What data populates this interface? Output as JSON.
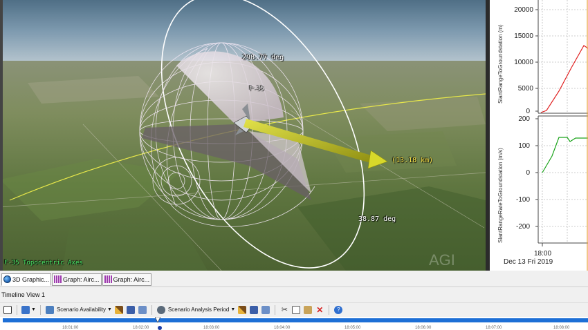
{
  "viewport": {
    "labels": {
      "azimuth": "298.77 deg",
      "elevation": "38.87 deg",
      "range": "(13.18 km)",
      "aircraft": "F-35",
      "axes": "F-35 Topocentric Axes",
      "watermark": "AGI"
    }
  },
  "graph": {
    "top_ylabel": "SlantRangeToGroundstation (m)",
    "bottom_ylabel": "SlantRangeRateToGroundstation (m/s)",
    "top_ticks": [
      "20000",
      "15000",
      "10000",
      "5000",
      "0"
    ],
    "bottom_ticks": [
      "200",
      "100",
      "0",
      "-100",
      "-200"
    ],
    "x_tick": "18:00",
    "x_date": "Dec 13 Fri 2019",
    "colors": {
      "top_series": "#e02020",
      "bottom_series": "#1aa31a"
    }
  },
  "tabs": [
    {
      "label": "3D Graphic...",
      "icon": "globe-icon",
      "active": true
    },
    {
      "label": "Graph:  Airc...",
      "icon": "bar-graph-icon",
      "active": false
    },
    {
      "label": "Graph:  Airc...",
      "icon": "bar-graph-icon",
      "active": false
    }
  ],
  "timeline": {
    "title": "Timeline View 1",
    "scenario_availability": "Scenario Availability",
    "scenario_analysis_period": "Scenario Analysis Period",
    "ticks": [
      "18:01:00",
      "18:02:00",
      "18:03:00",
      "18:04:00",
      "18:05:00",
      "18:06:00",
      "18:07:00",
      "18:08:00"
    ],
    "bar_color": "#1d6fd6"
  }
}
